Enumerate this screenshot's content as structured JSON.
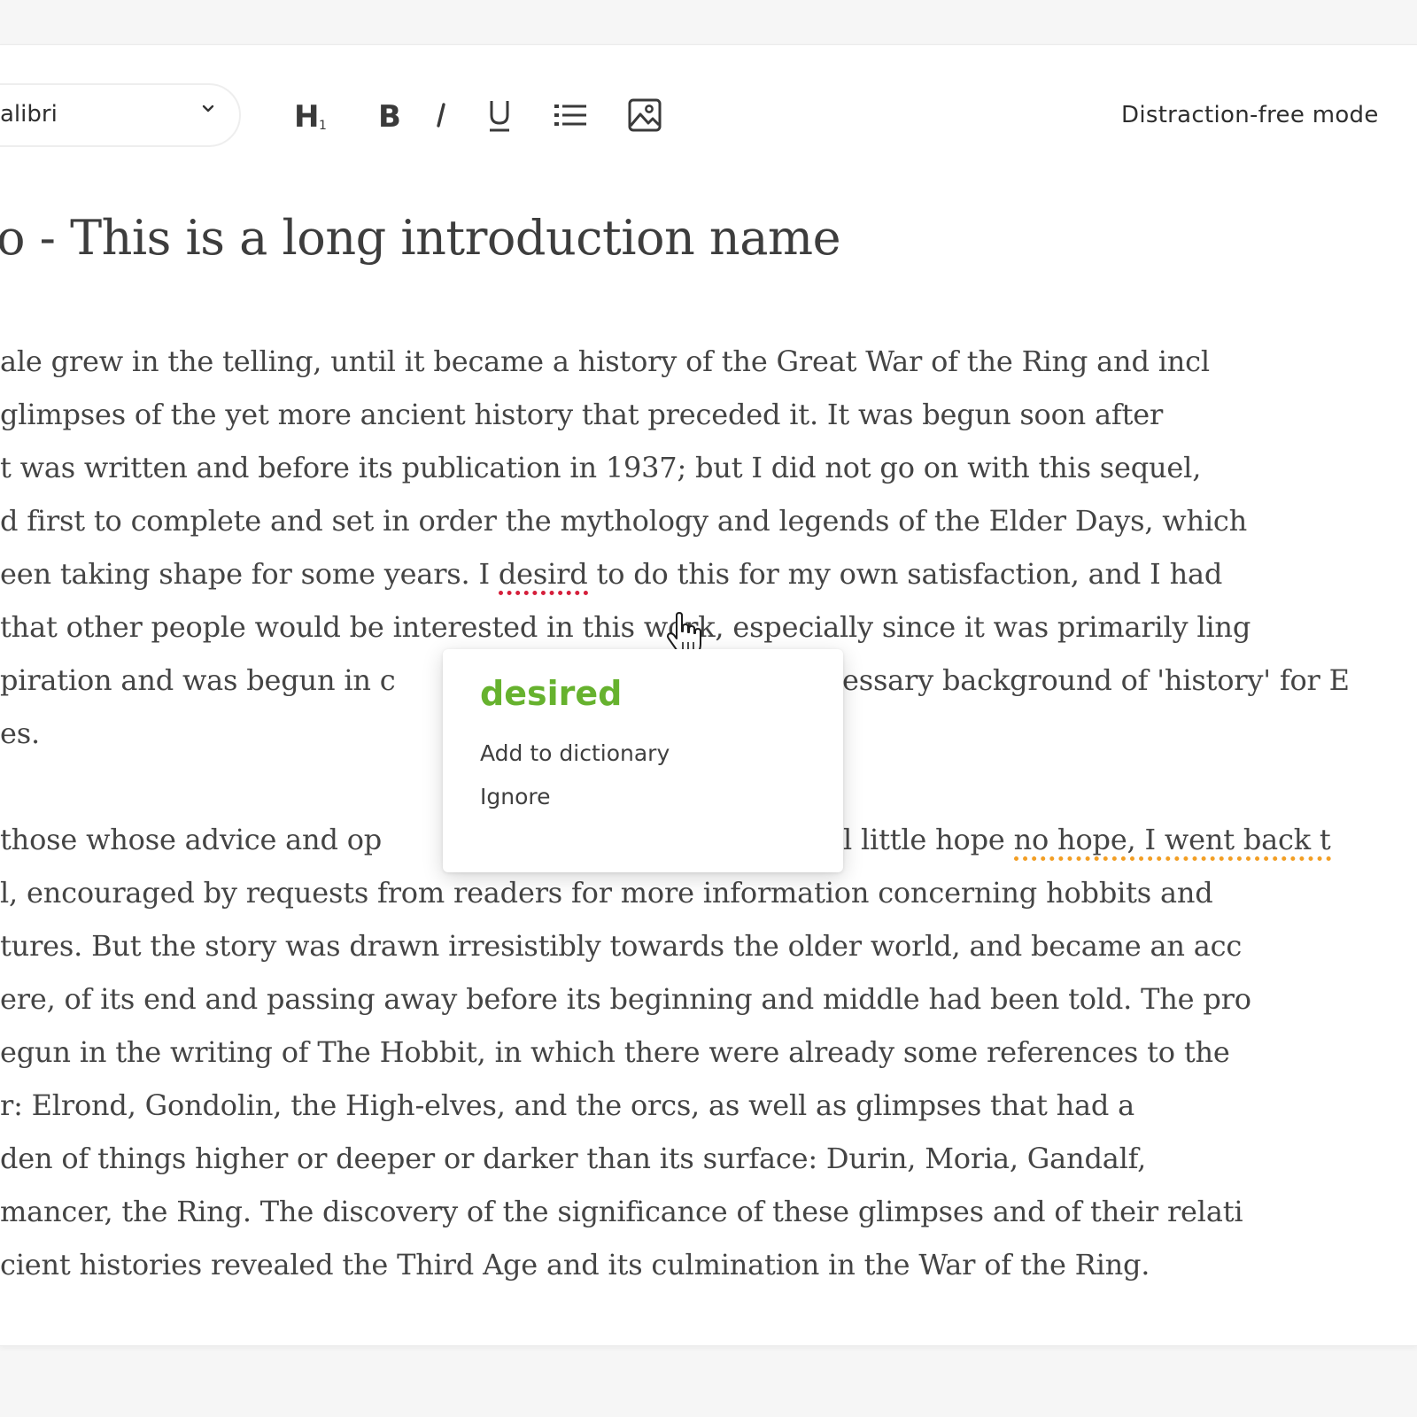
{
  "toolbar": {
    "font": "alibri",
    "tools": [
      {
        "name": "heading",
        "label": "H1"
      },
      {
        "name": "bold",
        "label": "B"
      },
      {
        "name": "italic",
        "label": "I"
      },
      {
        "name": "underline",
        "label": "U"
      },
      {
        "name": "bulleted-list",
        "label": ""
      },
      {
        "name": "insert-image",
        "label": ""
      }
    ],
    "distraction_free": "Distraction-free mode"
  },
  "document": {
    "title": "o - This is a long introduction name",
    "lines": [
      "ale grew in the telling, until it became a history of the Great War of the Ring and incl",
      " glimpses of the yet more ancient history that preceded it. It was begun soon after",
      "t was written and before its publication in 1937; but I did not go on with this sequel,",
      "d first to complete and set in order the mythology and legends of the Elder Days, which",
      "een taking shape for some years. I ",
      "that other people would be interested in this work, especially since it was primarily ling",
      "piration and was begun in c",
      "es.",
      " those whose advice and op",
      "l, encouraged by requests from readers for more information concerning hobbits and",
      "tures. But the story was drawn irresistibly towards the older world, and became an acc",
      "ere, of its end and passing away before its beginning and middle had been told. The pro",
      "egun in the writing of The Hobbit, in which there were already some references to the",
      "r: Elrond, Gondolin, the High-elves, and the orcs, as well as glimpses that had a",
      "den of things higher or deeper or darker than its surface: Durin, Moria, Gandalf,",
      "mancer, the Ring. The discovery of the significance of these glimpses and of their relati",
      "cient histories revealed the Third Age and its culmination in the War of the Ring."
    ],
    "line5_misspelled": "desird",
    "line5_rest": " to do this for my own satisfaction, and I had",
    "line7_tail": "essary background of 'history' for E",
    "line9_tail_plain": "l little hope ",
    "line9_grammar": "no hope, I went back t",
    "colors": {
      "misspelling": "#d51f3b",
      "grammar": "#f29e24",
      "suggestion": "#66b22e"
    }
  },
  "popup": {
    "suggestion": "desired",
    "add_to_dictionary": "Add to dictionary",
    "ignore": "Ignore"
  }
}
